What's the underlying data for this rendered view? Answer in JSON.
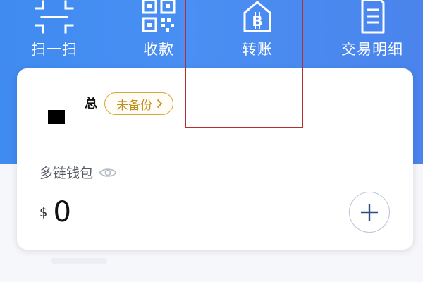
{
  "actions": [
    {
      "id": "scan",
      "label": "扫一扫",
      "icon": "scan-icon"
    },
    {
      "id": "receive",
      "label": "收款",
      "icon": "qrcode-icon"
    },
    {
      "id": "transfer",
      "label": "转账",
      "icon": "bitcoin-house-icon"
    },
    {
      "id": "history",
      "label": "交易明细",
      "icon": "document-icon"
    }
  ],
  "wallet": {
    "name": "总",
    "backup_badge": "未备份",
    "type": "多链钱包",
    "currency_symbol": "$",
    "balance": "0"
  },
  "colors": {
    "header_blue": "#4a8ff3",
    "badge_gold": "#c08f1f",
    "highlight_red": "#b5302d"
  }
}
